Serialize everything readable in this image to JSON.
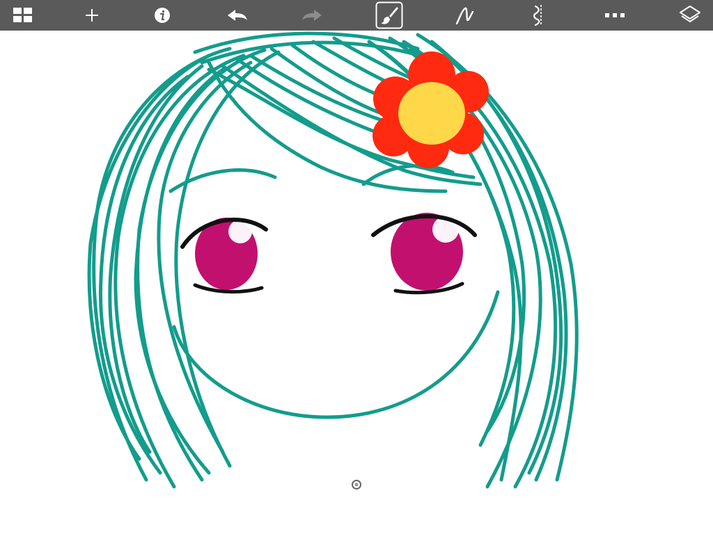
{
  "app": {
    "toolbar": {
      "background": "#5a5a5a",
      "tools": [
        {
          "name": "gallery",
          "icon": "grid-icon",
          "enabled": true
        },
        {
          "name": "new",
          "icon": "plus-icon",
          "enabled": true
        },
        {
          "name": "info",
          "icon": "info-icon",
          "enabled": true
        },
        {
          "name": "undo",
          "icon": "undo-icon",
          "enabled": true
        },
        {
          "name": "redo",
          "icon": "redo-icon",
          "enabled": false
        },
        {
          "name": "brush",
          "icon": "brush-icon",
          "selected": true
        },
        {
          "name": "stroke-style",
          "icon": "stroke-icon",
          "enabled": true
        },
        {
          "name": "symmetry",
          "icon": "symmetry-icon",
          "enabled": true
        },
        {
          "name": "more",
          "icon": "more-icon",
          "enabled": true
        },
        {
          "name": "layers",
          "icon": "layers-icon",
          "enabled": true
        }
      ]
    },
    "canvas": {
      "background": "#ffffff",
      "colors": {
        "hair": "#139c8c",
        "eye_iris": "#c2106e",
        "eye_highlight": "#ffffff",
        "eyelash": "#111111",
        "flower_petals": "#ff2a0f",
        "flower_center": "#ffd84a"
      }
    }
  }
}
